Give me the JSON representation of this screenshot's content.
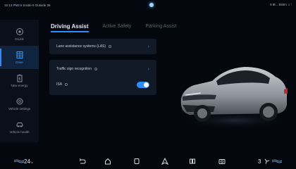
{
  "statusbar": {
    "left": "15:13  PM2.5 Inside 9  Outside 36",
    "right": "9 ⊞  ...556m  ♫  ⁞"
  },
  "sidebar": {
    "items": [
      {
        "label": "DiLink",
        "icon": "circle-dot-icon",
        "active": false
      },
      {
        "label": "Drive",
        "icon": "steering-grid-icon",
        "active": true
      },
      {
        "label": "New energy",
        "icon": "battery-icon",
        "active": false
      },
      {
        "label": "Vehicle settings",
        "icon": "gear-icon",
        "active": false
      },
      {
        "label": "Vehicle health",
        "icon": "car-icon",
        "active": false
      }
    ]
  },
  "tabs": [
    {
      "label": "Driving Assist",
      "active": true
    },
    {
      "label": "Active Safety",
      "active": false
    },
    {
      "label": "Parking Assist",
      "active": false
    }
  ],
  "settings": {
    "lane": "Lane assistance systems (LAS)",
    "traffic_sign": "Traffic sign recognition",
    "isa": "ISA",
    "isa_enabled": true
  },
  "bottombar": {
    "left_temp": "24",
    "left_unit": "°c",
    "right_temp": "3"
  },
  "colors": {
    "accent": "#2d8cff",
    "background": "#04070e",
    "card": "#121a28"
  }
}
